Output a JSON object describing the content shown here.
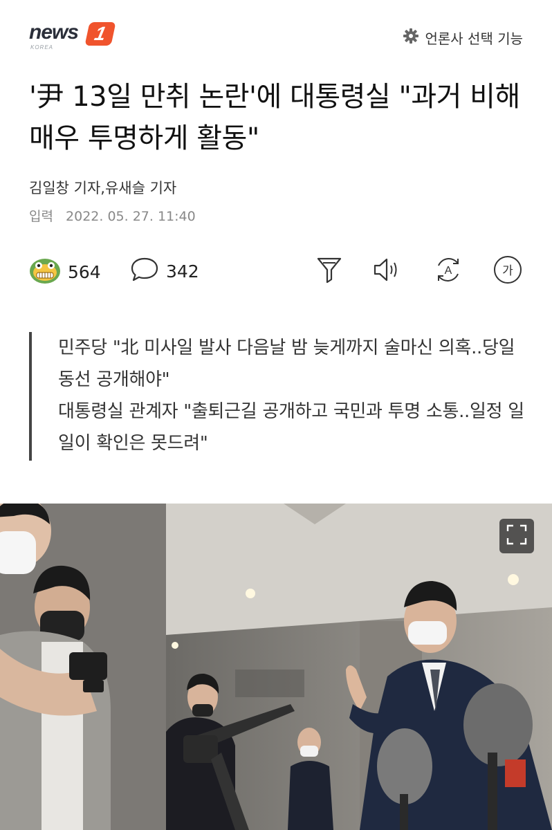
{
  "header": {
    "logo_text": "news",
    "logo_badge": "1",
    "logo_sub": "KOREA",
    "press_select_label": "언론사 선택 기능"
  },
  "article": {
    "headline": "'尹 13일 만취 논란'에 대통령실 \"과거 비해 매우 투명하게 활동\"",
    "byline": "김일창 기자,유새슬 기자",
    "timestamp_label": "입력",
    "timestamp_value": "2022. 05. 27. 11:40"
  },
  "actions": {
    "reaction_count": "564",
    "comment_count": "342",
    "icons": [
      "reaction-emoji-icon",
      "comment-icon",
      "summary-icon",
      "tts-icon",
      "translate-icon",
      "font-size-icon"
    ],
    "font_size_label": "가",
    "translate_label": "A"
  },
  "summary": {
    "lines": [
      "민주당 \"北 미사일 발사 다음날 밤 늦게까지 술마신 의혹..당일 동선 공개해야\"",
      "대통령실 관계자 \"출퇴근길 공개하고 국민과 투명 소통..일정 일일이 확인은 못드려\""
    ]
  },
  "photo": {
    "expand_icon": "expand-icon"
  },
  "colors": {
    "brand": "#f0542d",
    "quote_bar": "#444444",
    "photo_bg": "#9a9894"
  }
}
